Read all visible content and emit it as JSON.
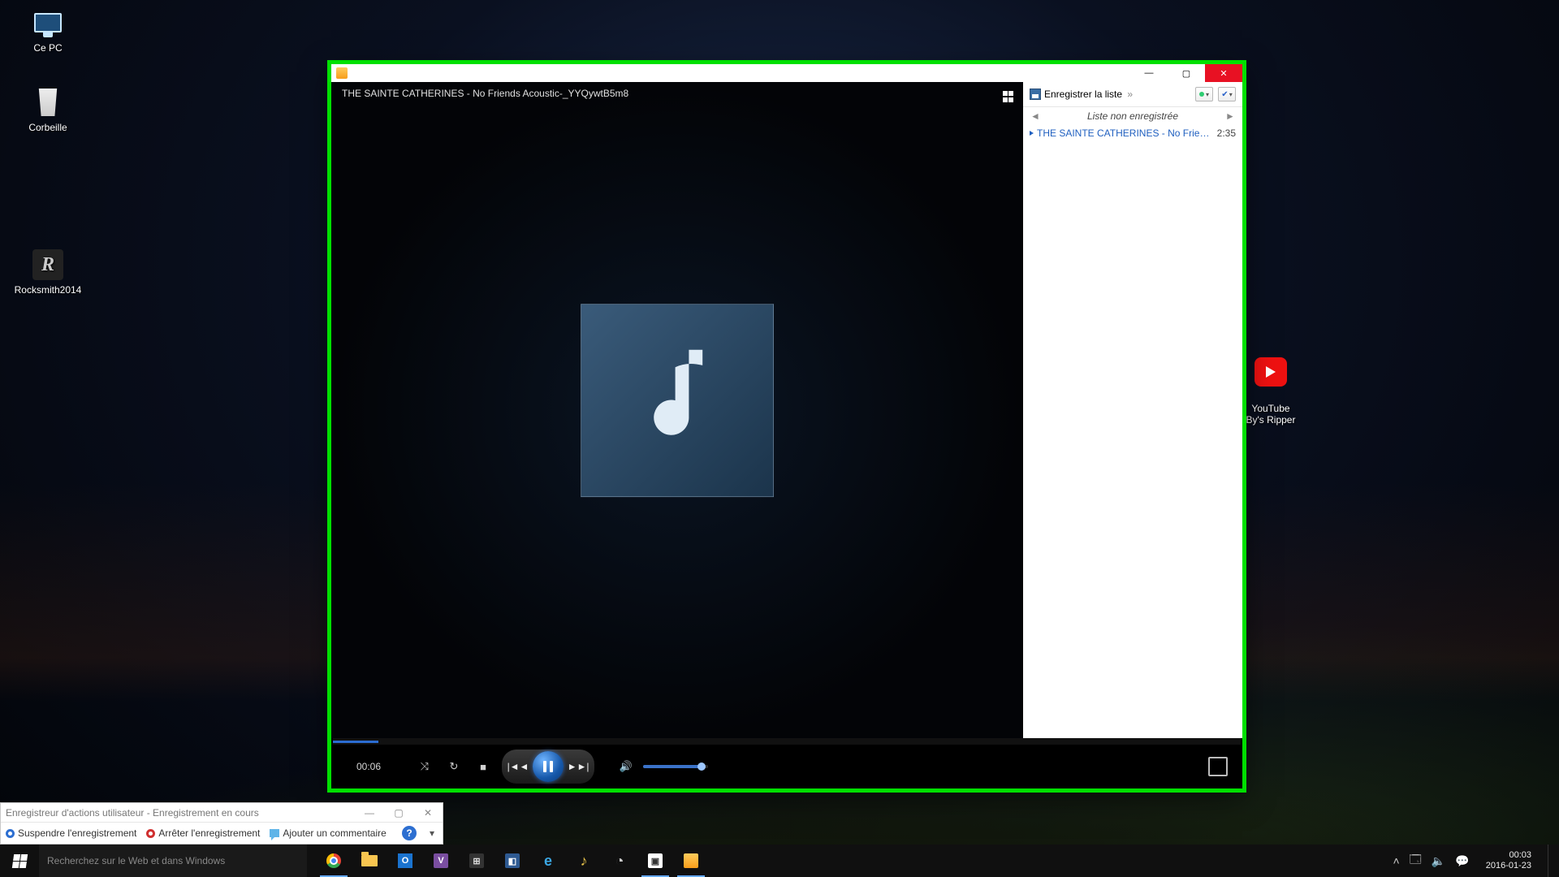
{
  "desktop": {
    "pc": "Ce PC",
    "trash": "Corbeille",
    "rocksmith": "Rocksmith2014",
    "youtube": "YouTube\nBy's Ripper"
  },
  "player": {
    "nowPlaying": "THE SAINTE CATHERINES - No Friends Acoustic-_YYQywtB5m8",
    "elapsed": "00:06",
    "sidebar": {
      "save": "Enregistrer la liste",
      "unsaved": "Liste non enregistrée",
      "track": {
        "name": "THE SAINTE CATHERINES - No Frien…",
        "duration": "2:35"
      }
    }
  },
  "recorder": {
    "title": "Enregistreur d'actions utilisateur - Enregistrement en cours",
    "pause": "Suspendre l'enregistrement",
    "stop": "Arrêter l'enregistrement",
    "comment": "Ajouter un commentaire"
  },
  "taskbar": {
    "searchPlaceholder": "Recherchez sur le Web et dans Windows",
    "clockTime": "00:03",
    "clockDate": "2016-01-23"
  }
}
